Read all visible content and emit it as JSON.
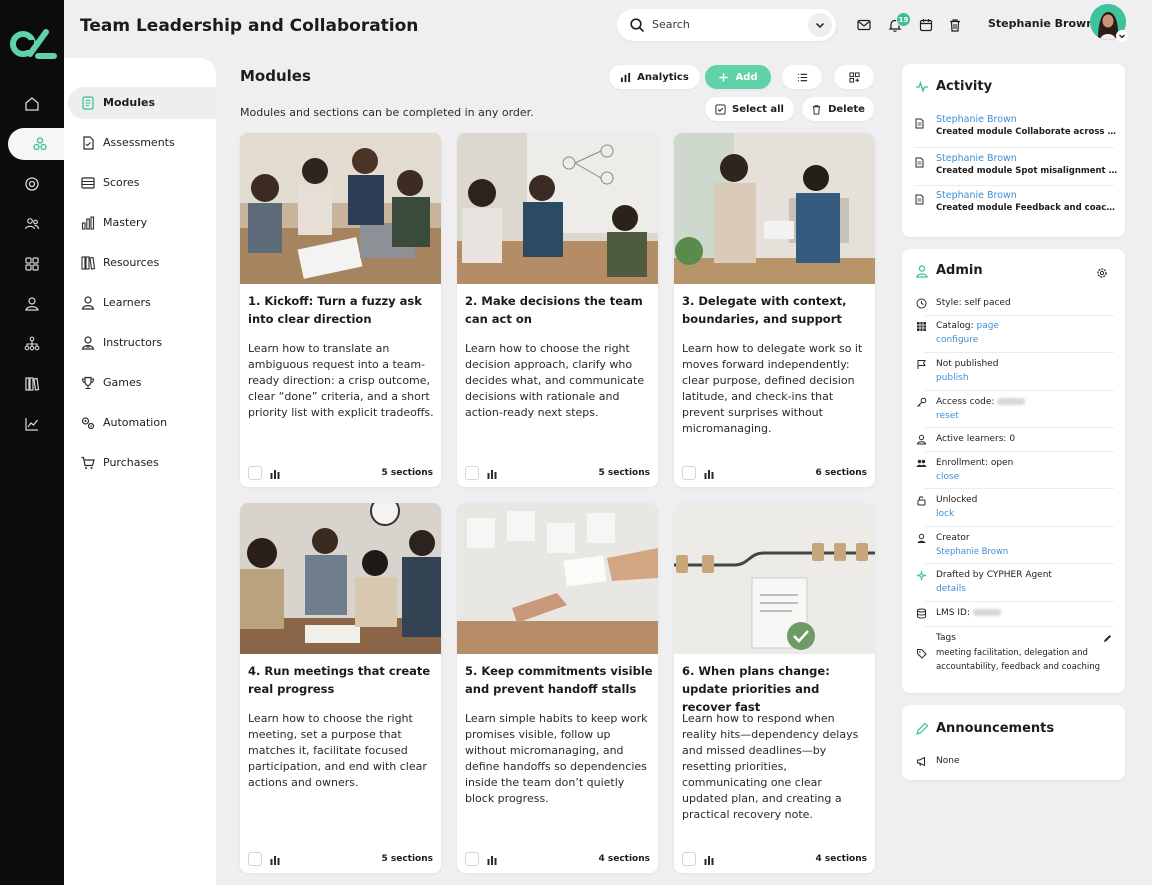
{
  "header": {
    "title": "Team Leadership and Collaboration",
    "search_placeholder": "Search",
    "notification_count": "19",
    "user_name": "Stephanie Brown"
  },
  "rail": {
    "items": [
      "home-icon",
      "modules-icon",
      "target-icon",
      "people-icon",
      "grid-icon",
      "person-icon",
      "org-icon",
      "library-icon",
      "analytics-icon"
    ],
    "accent": "#5fd3a7"
  },
  "subnav": {
    "items": [
      {
        "label": "Modules",
        "icon": "module-icon"
      },
      {
        "label": "Assessments",
        "icon": "assessment-icon"
      },
      {
        "label": "Scores",
        "icon": "scores-icon"
      },
      {
        "label": "Mastery",
        "icon": "mastery-icon"
      },
      {
        "label": "Resources",
        "icon": "resources-icon"
      },
      {
        "label": "Learners",
        "icon": "learners-icon"
      },
      {
        "label": "Instructors",
        "icon": "instructors-icon"
      },
      {
        "label": "Games",
        "icon": "trophy-icon"
      },
      {
        "label": "Automation",
        "icon": "gears-icon"
      },
      {
        "label": "Purchases",
        "icon": "cart-icon"
      }
    ]
  },
  "main": {
    "title": "Modules",
    "subtitle": "Modules and sections can be completed in any order.",
    "toolbar": {
      "analytics": "Analytics",
      "add": "Add",
      "select_all": "Select all",
      "delete": "Delete"
    },
    "modules": [
      {
        "title": "1. Kickoff: Turn a fuzzy ask into clear direction",
        "desc": "Learn how to translate an ambiguous request into a team-ready direction: a crisp outcome, clear “done” criteria, and a short priority list with explicit tradeoffs.",
        "sections": "5 sections"
      },
      {
        "title": "2. Make decisions the team can act on",
        "desc": "Learn how to choose the right decision approach, clarify who decides what, and communicate decisions with rationale and action-ready next steps.",
        "sections": "5 sections"
      },
      {
        "title": "3. Delegate with context, boundaries, and support",
        "desc": "Learn how to delegate work so it moves forward independently: clear purpose, defined decision latitude, and check-ins that prevent surprises without micromanaging.",
        "sections": "6 sections"
      },
      {
        "title": "4. Run meetings that create real progress",
        "desc": "Learn how to choose the right meeting, set a purpose that matches it, facilitate focused participation, and end with clear actions and owners.",
        "sections": "5 sections"
      },
      {
        "title": "5. Keep commitments visible and prevent handoff stalls",
        "desc": "Learn simple habits to keep work promises visible, follow up without micromanaging, and define handoffs so dependencies inside the team don’t quietly block progress.",
        "sections": "4 sections"
      },
      {
        "title": "6. When plans change: update priorities and recover fast",
        "desc": "Learn how to respond when reality hits—dependency delays and missed deadlines—by resetting priorities, communicating one clear updated plan, and creating a practical recovery note.",
        "sections": "4 sections"
      }
    ]
  },
  "activity": {
    "title": "Activity",
    "items": [
      {
        "name": "Stephanie Brown",
        "msg": "Created module Collaborate across roles"
      },
      {
        "name": "Stephanie Brown",
        "msg": "Created module Spot misalignment early"
      },
      {
        "name": "Stephanie Brown",
        "msg": "Created module Feedback and coaching"
      }
    ]
  },
  "admin": {
    "title": "Admin",
    "style": "Style: self paced",
    "catalog_label": "Catalog:",
    "catalog_page": "page",
    "catalog_configure": "configure",
    "published": "Not published",
    "publish": "publish",
    "access_label": "Access code:",
    "access_reset": "reset",
    "active_learners": "Active learners: 0",
    "enrollment": "Enrollment: open",
    "enrollment_close": "close",
    "unlocked": "Unlocked",
    "lock": "lock",
    "creator_label": "Creator",
    "creator_name": "Stephanie Brown",
    "drafted": "Drafted by CYPHER Agent",
    "drafted_details": "details",
    "lms_label": "LMS ID:",
    "tags_label": "Tags",
    "tags_line1": "meeting facilitation, delegation and",
    "tags_line2": "accountability, feedback and coaching"
  },
  "announcements": {
    "title": "Announcements",
    "value": "None"
  }
}
